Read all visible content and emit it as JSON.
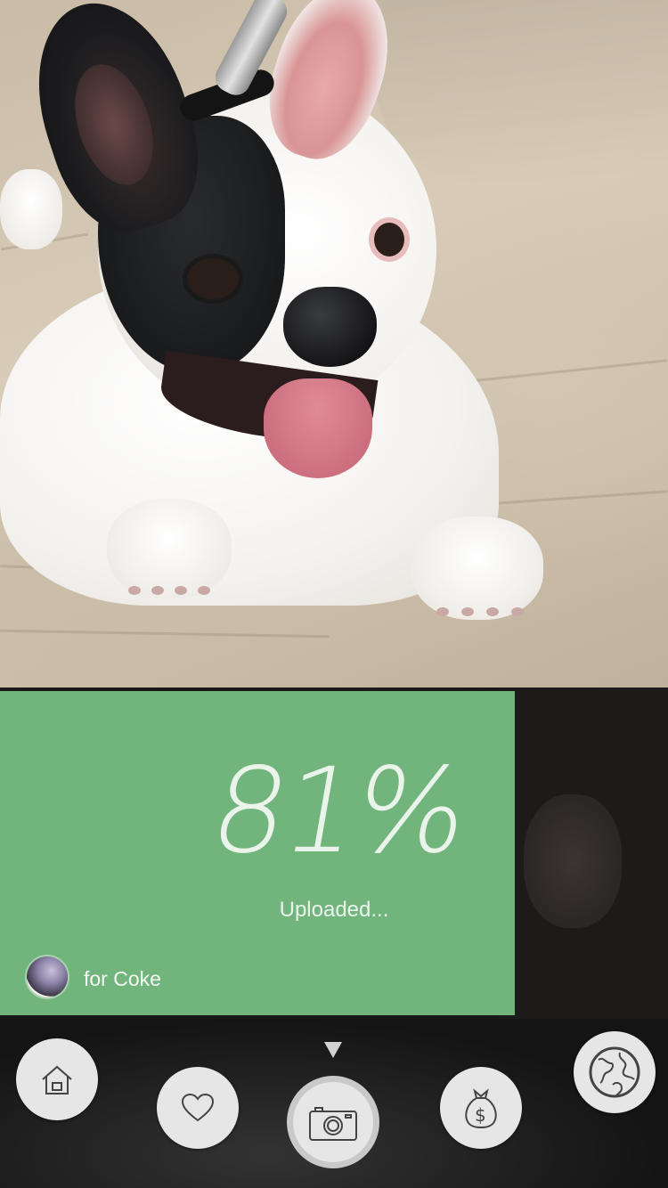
{
  "upload": {
    "percent_text": "81%",
    "progress": 0.81,
    "status": "Uploaded...",
    "recipient_label": "for Coke"
  },
  "colors": {
    "card": "#72b57c",
    "tabbar": "#121212",
    "button": "#e6e6e6"
  },
  "tabbar": {
    "icons": [
      "home-icon",
      "heart-icon",
      "camera-icon",
      "money-bag-icon",
      "globe-icon"
    ]
  }
}
